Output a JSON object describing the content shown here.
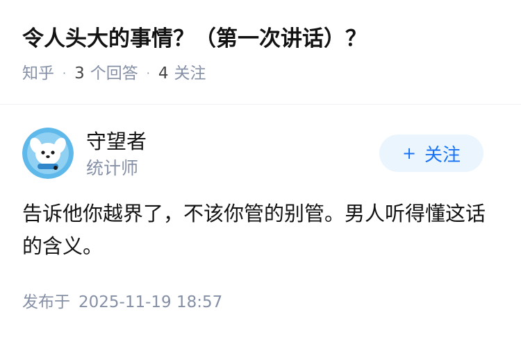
{
  "question": {
    "title": "令人头大的事情？（第一次讲话）？",
    "source": "知乎",
    "answers_count": "3",
    "answers_label": "个回答",
    "followers_count": "4",
    "followers_label": "关注"
  },
  "author": {
    "name": "守望者",
    "bio": "统计师",
    "avatar_icon": "cartoon-dog-avatar",
    "follow_label": "关注",
    "follow_icon": "plus-icon"
  },
  "answer": {
    "content": "告诉他你越界了，不该你管的别管。男人听得懂这话的含义。",
    "published_label": "发布于",
    "published_time": "2025-11-19 18:57"
  },
  "colors": {
    "accent": "#1772f6",
    "follow_bg": "#ebf5fd",
    "meta_gray": "#8590a6",
    "text": "#121212"
  }
}
